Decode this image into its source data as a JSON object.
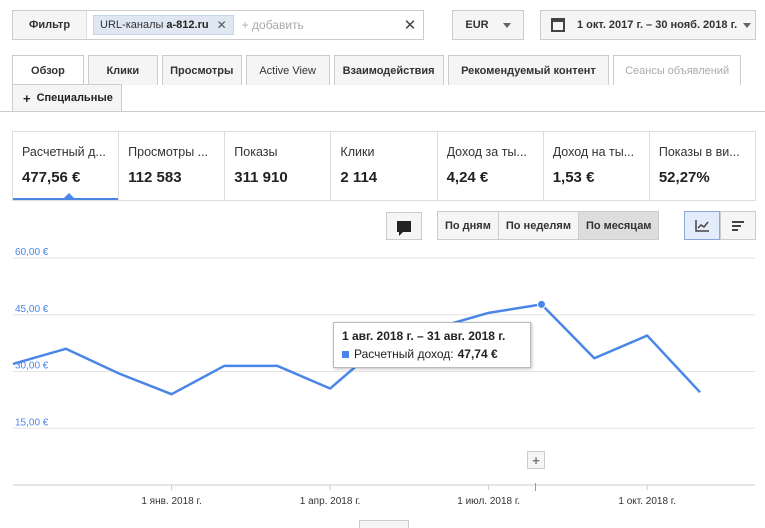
{
  "filter": {
    "button_label": "Фильтр",
    "chip_label": "URL-каналы",
    "chip_value": "a-812.ru",
    "add_placeholder": "+ добавить"
  },
  "currency": "EUR",
  "date_range": "1 окт. 2017 г. – 30 нояб. 2018 г.",
  "tabs": [
    {
      "label": "Обзор",
      "state": "active"
    },
    {
      "label": "Клики",
      "state": "normal"
    },
    {
      "label": "Просмотры",
      "state": "normal"
    },
    {
      "label": "Active View",
      "state": "normal"
    },
    {
      "label": "Взаимодействия",
      "state": "normal"
    },
    {
      "label": "Рекомендуемый контент",
      "state": "normal"
    },
    {
      "label": "Сеансы объявлений",
      "state": "disabled"
    }
  ],
  "special_tab": "Специальные",
  "metrics": [
    {
      "label": "Расчетный д...",
      "value": "477,56 €"
    },
    {
      "label": "Просмотры ...",
      "value": "112 583"
    },
    {
      "label": "Показы",
      "value": "311 910"
    },
    {
      "label": "Клики",
      "value": "2 114"
    },
    {
      "label": "Доход за ты...",
      "value": "4,24 €"
    },
    {
      "label": "Доход на ты...",
      "value": "1,53 €"
    },
    {
      "label": "Показы в ви...",
      "value": "52,27%"
    }
  ],
  "period_buttons": [
    {
      "label": "По дням",
      "active": false
    },
    {
      "label": "По неделям",
      "active": false
    },
    {
      "label": "По месяцам",
      "active": true
    }
  ],
  "icons": {
    "comment": "comment-icon",
    "line_view": "line-chart-icon",
    "bar_view": "bar-chart-icon",
    "calendar": "calendar-icon"
  },
  "tooltip": {
    "title": "1 авг. 2018 г. – 31 авг. 2018 г.",
    "label": "Расчетный доход:",
    "value": "47,74 €"
  },
  "annotation_plus": "+",
  "chart_data": {
    "type": "line",
    "x": [
      "2017-10",
      "2017-11",
      "2017-12",
      "2018-01",
      "2018-02",
      "2018-03",
      "2018-04",
      "2018-05",
      "2018-06",
      "2018-07",
      "2018-08",
      "2018-09",
      "2018-10",
      "2018-11"
    ],
    "series": [
      {
        "values": [
          32.0,
          36.0,
          29.5,
          24.0,
          31.5,
          31.5,
          25.5,
          37.5,
          41.5,
          45.5,
          47.74,
          33.5,
          39.5,
          24.5
        ]
      }
    ],
    "xtick_labels": [
      {
        "x": "2018-01",
        "label": "1 янв. 2018 г."
      },
      {
        "x": "2018-04",
        "label": "1 апр. 2018 г."
      },
      {
        "x": "2018-07",
        "label": "1 июл. 2018 г."
      },
      {
        "x": "2018-10",
        "label": "1 окт. 2018 г."
      }
    ],
    "yticks": [
      15,
      30,
      45,
      60
    ],
    "ytick_labels": [
      "15,00 €",
      "30,00 €",
      "45,00 €",
      "60,00 €"
    ],
    "ylim": [
      0,
      60
    ],
    "highlight_index": 10,
    "color": "#4a86e8",
    "grid": true
  }
}
